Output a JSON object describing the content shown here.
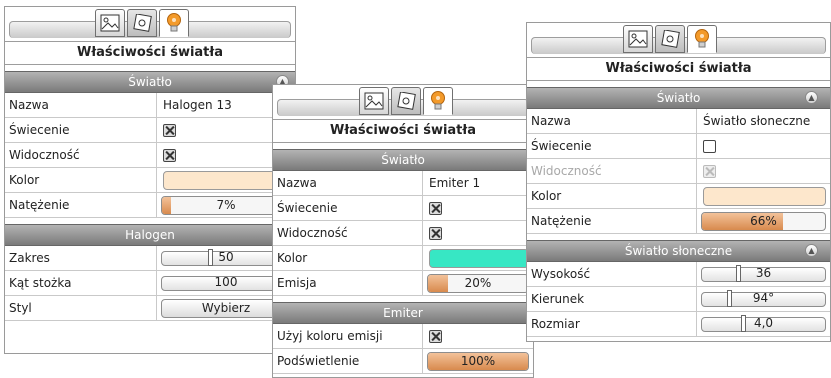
{
  "panel1": {
    "title": "Właściwości światła",
    "sections": {
      "swiatlo": "Światło",
      "halogen": "Halogen"
    },
    "rows": {
      "nazwa_label": "Nazwa",
      "nazwa_value": "Halogen 13",
      "swiecenie_label": "Świecenie",
      "widocznosc_label": "Widoczność",
      "kolor_label": "Kolor",
      "kolor_color": "#fde7cc",
      "natezenie_label": "Natężenie",
      "natezenie_value": "7%",
      "natezenie_fraction": 0.07,
      "zakres_label": "Zakres",
      "zakres_value": "50",
      "kat_label": "Kąt stożka",
      "kat_value": "100",
      "styl_label": "Styl",
      "styl_button": "Wybierz"
    }
  },
  "panel2": {
    "title": "Właściwości światła",
    "sections": {
      "swiatlo": "Światło",
      "emiter": "Emiter"
    },
    "rows": {
      "nazwa_label": "Nazwa",
      "nazwa_value": "Emiter 1",
      "swiecenie_label": "Świecenie",
      "widocznosc_label": "Widoczność",
      "kolor_label": "Kolor",
      "kolor_color": "#37e7c4",
      "emisja_label": "Emisja",
      "emisja_value": "20%",
      "emisja_fraction": 0.2,
      "uzyj_label": "Użyj koloru emisji",
      "podswietlenie_label": "Podświetlenie",
      "podswietlenie_value": "100%",
      "podswietlenie_fraction": 1.0
    }
  },
  "panel3": {
    "title": "Właściwości światła",
    "sections": {
      "swiatlo": "Światło",
      "sloneczne": "Światło słoneczne"
    },
    "rows": {
      "nazwa_label": "Nazwa",
      "nazwa_value": "Światło słoneczne",
      "swiecenie_label": "Świecenie",
      "widocznosc_label": "Widoczność",
      "kolor_label": "Kolor",
      "kolor_color": "#fde7cc",
      "natezenie_label": "Natężenie",
      "natezenie_value": "66%",
      "natezenie_fraction": 0.66,
      "wysokosc_label": "Wysokość",
      "wysokosc_value": "36",
      "kierunek_label": "Kierunek",
      "kierunek_value": "94°",
      "rozmiar_label": "Rozmiar",
      "rozmiar_value": "4,0"
    }
  },
  "tabs": {
    "icons": [
      "scene-image-icon",
      "object-image-icon",
      "light-bulb-icon"
    ]
  },
  "colors": {
    "accent_orange": "#d88a4e",
    "section_header": "#8a8a8a",
    "bulb_orange": "#f39a2a"
  }
}
